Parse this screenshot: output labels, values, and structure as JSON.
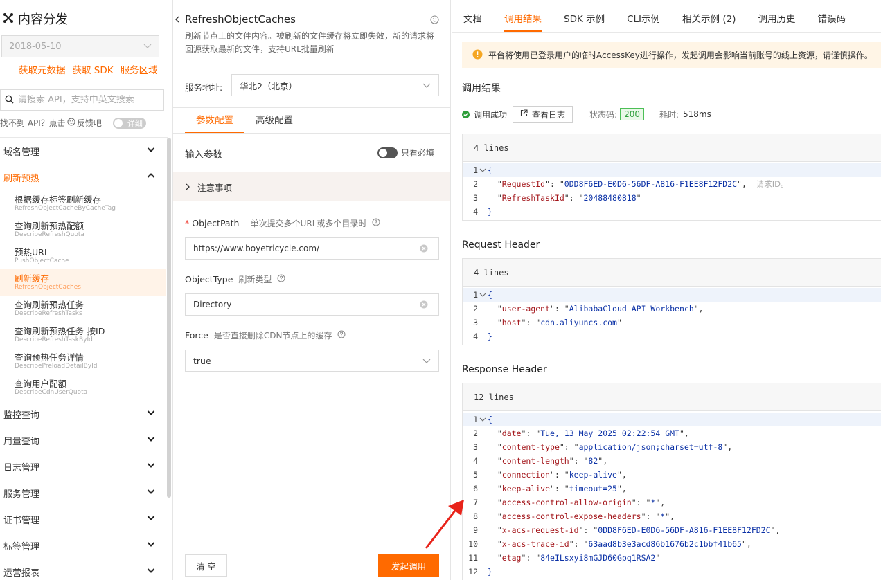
{
  "sidebar": {
    "product_title": "内容分发",
    "date_value": "2018-05-10",
    "quick_links": [
      "获取元数据",
      "获取 SDK",
      "服务区域"
    ],
    "search_placeholder": "请搜索 API，支持中英文搜索",
    "feedback_text": "找不到 API？点击",
    "feedback_link": "反馈吧",
    "detail_toggle": "详细",
    "groups_top": [
      {
        "label": "域名管理",
        "expanded": false
      }
    ],
    "active_group": {
      "label": "刷新预热",
      "expanded": true
    },
    "items": [
      {
        "cn": "根据缓存标签刷新缓存",
        "en": "RefreshObjectCacheByCacheTag"
      },
      {
        "cn": "查询刷新预热配额",
        "en": "DescribeRefreshQuota"
      },
      {
        "cn": "预热URL",
        "en": "PushObjectCache"
      },
      {
        "cn": "刷新缓存",
        "en": "RefreshObjectCaches",
        "active": true
      },
      {
        "cn": "查询刷新预热任务",
        "en": "DescribeRefreshTasks"
      },
      {
        "cn": "查询刷新预热任务-按ID",
        "en": "DescribeRefreshTaskById"
      },
      {
        "cn": "查询预热任务详情",
        "en": "DescribePreloadDetailById"
      },
      {
        "cn": "查询用户配额",
        "en": "DescribeCdnUserQuota"
      }
    ],
    "groups_bottom": [
      {
        "label": "监控查询"
      },
      {
        "label": "用量查询"
      },
      {
        "label": "日志管理"
      },
      {
        "label": "服务管理"
      },
      {
        "label": "证书管理"
      },
      {
        "label": "标签管理"
      },
      {
        "label": "运营报表"
      }
    ]
  },
  "middle": {
    "api_name": "RefreshObjectCaches",
    "api_desc": "刷新节点上的文件内容。被刷新的文件缓存将立即失效，新的请求将回源获取最新的文件，支持URL批量刷新",
    "service_label": "服务地址:",
    "service_value": "华北2（北京）",
    "tabs": [
      "参数配置",
      "高级配置"
    ],
    "active_tab": 0,
    "input_params_title": "输入参数",
    "required_only_label": "只看必填",
    "notes_label": "注意事项",
    "params": [
      {
        "name": "ObjectPath",
        "required": true,
        "hint": "- 单次提交多个URL或多个目录时",
        "value": "https://www.boyetricycle.com/",
        "kind": "input"
      },
      {
        "name": "ObjectType",
        "required": false,
        "hint": "刷新类型",
        "value": "Directory",
        "kind": "input"
      },
      {
        "name": "Force",
        "required": false,
        "hint": "是否直接删除CDN节点上的缓存",
        "value": "true",
        "kind": "select"
      }
    ],
    "clear_button": "清 空",
    "invoke_button": "发起调用"
  },
  "right": {
    "tabs": [
      "文档",
      "调用结果",
      "SDK 示例",
      "CLI示例",
      "相关示例 (2)",
      "调用历史",
      "错误码"
    ],
    "active_tab": 1,
    "warning": "平台将使用已登录用户的临时AccessKey进行操作，发起调用会影响当前账号的线上资源，请谨慎操作。",
    "result_title": "调用结果",
    "status_text": "调用成功",
    "view_log_button": "查看日志",
    "status_code_label": "状态码:",
    "status_code": "200",
    "time_label": "耗时:",
    "time_value": "518ms",
    "result_block": {
      "header": "4 lines",
      "lines": [
        {
          "n": "1",
          "t": "{"
        },
        {
          "n": "2",
          "k": "RequestId",
          "v": "0DD8F6ED-E0D6-56DF-A816-F1EE8F12FD2C",
          "comma": true,
          "comment": "请求ID。"
        },
        {
          "n": "3",
          "k": "RefreshTaskId",
          "v": "20488480818",
          "comma": false
        },
        {
          "n": "4",
          "t": "}"
        }
      ]
    },
    "request_header_title": "Request Header",
    "request_block": {
      "header": "4 lines",
      "lines": [
        {
          "n": "1",
          "t": "{"
        },
        {
          "n": "2",
          "k": "user-agent",
          "v": "AlibabaCloud API Workbench",
          "comma": true
        },
        {
          "n": "3",
          "k": "host",
          "v": "cdn.aliyuncs.com",
          "comma": false
        },
        {
          "n": "4",
          "t": "}"
        }
      ]
    },
    "response_header_title": "Response Header",
    "response_block": {
      "header": "12 lines",
      "lines": [
        {
          "n": "1",
          "t": "{"
        },
        {
          "n": "2",
          "k": "date",
          "v": "Tue, 13 May 2025 02:22:54 GMT",
          "comma": true
        },
        {
          "n": "3",
          "k": "content-type",
          "v": "application/json;charset=utf-8",
          "comma": true
        },
        {
          "n": "4",
          "k": "content-length",
          "v": "82",
          "comma": true
        },
        {
          "n": "5",
          "k": "connection",
          "v": "keep-alive",
          "comma": true
        },
        {
          "n": "6",
          "k": "keep-alive",
          "v": "timeout=25",
          "comma": true
        },
        {
          "n": "7",
          "k": "access-control-allow-origin",
          "v": "*",
          "comma": true
        },
        {
          "n": "8",
          "k": "access-control-expose-headers",
          "v": "*",
          "comma": true
        },
        {
          "n": "9",
          "k": "x-acs-request-id",
          "v": "0DD8F6ED-E0D6-56DF-A816-F1EE8F12FD2C",
          "comma": true
        },
        {
          "n": "10",
          "k": "x-acs-trace-id",
          "v": "63aad8b3e3acd86b1676b2c1bbf41b65",
          "comma": true
        },
        {
          "n": "11",
          "k": "etag",
          "v": "84eILsxyi8mGJD60Gpq1RSA2",
          "comma": false
        },
        {
          "n": "12",
          "t": "}"
        }
      ]
    }
  },
  "colors": {
    "accent": "#ff6a00",
    "success": "#2e9e3a",
    "annotation_arrow": "#e8231a"
  }
}
